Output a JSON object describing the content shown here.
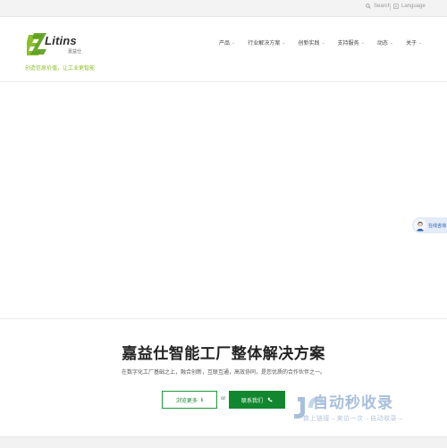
{
  "topbar": {
    "search_label": "Search",
    "language_label": "Language"
  },
  "brand": {
    "name": "Litins",
    "sub": "嘉益仕",
    "slogan": "创造信息价值，让工业更智能",
    "color": "#8cbf2c"
  },
  "nav": {
    "items": [
      {
        "label": "产品"
      },
      {
        "label": "行业解决方案"
      },
      {
        "label": "创新实践"
      },
      {
        "label": "支持服务"
      },
      {
        "label": "动态"
      },
      {
        "label": "关于"
      }
    ]
  },
  "float": {
    "label": "在线咨询"
  },
  "hero": {
    "title": "嘉益仕智能工厂整体解决方案",
    "description": "在数字化工厂基础之上，融合创新，互联互通，高效协同，是您优质的合作伙伴之一。",
    "browse_label": "浏览更多",
    "or_label": "or",
    "contact_label": "联系我们",
    "accent_color": "#13872f"
  },
  "watermark": {
    "text": "自动秒收录",
    "sub": "数上链接→来访一次→自动收录→"
  }
}
